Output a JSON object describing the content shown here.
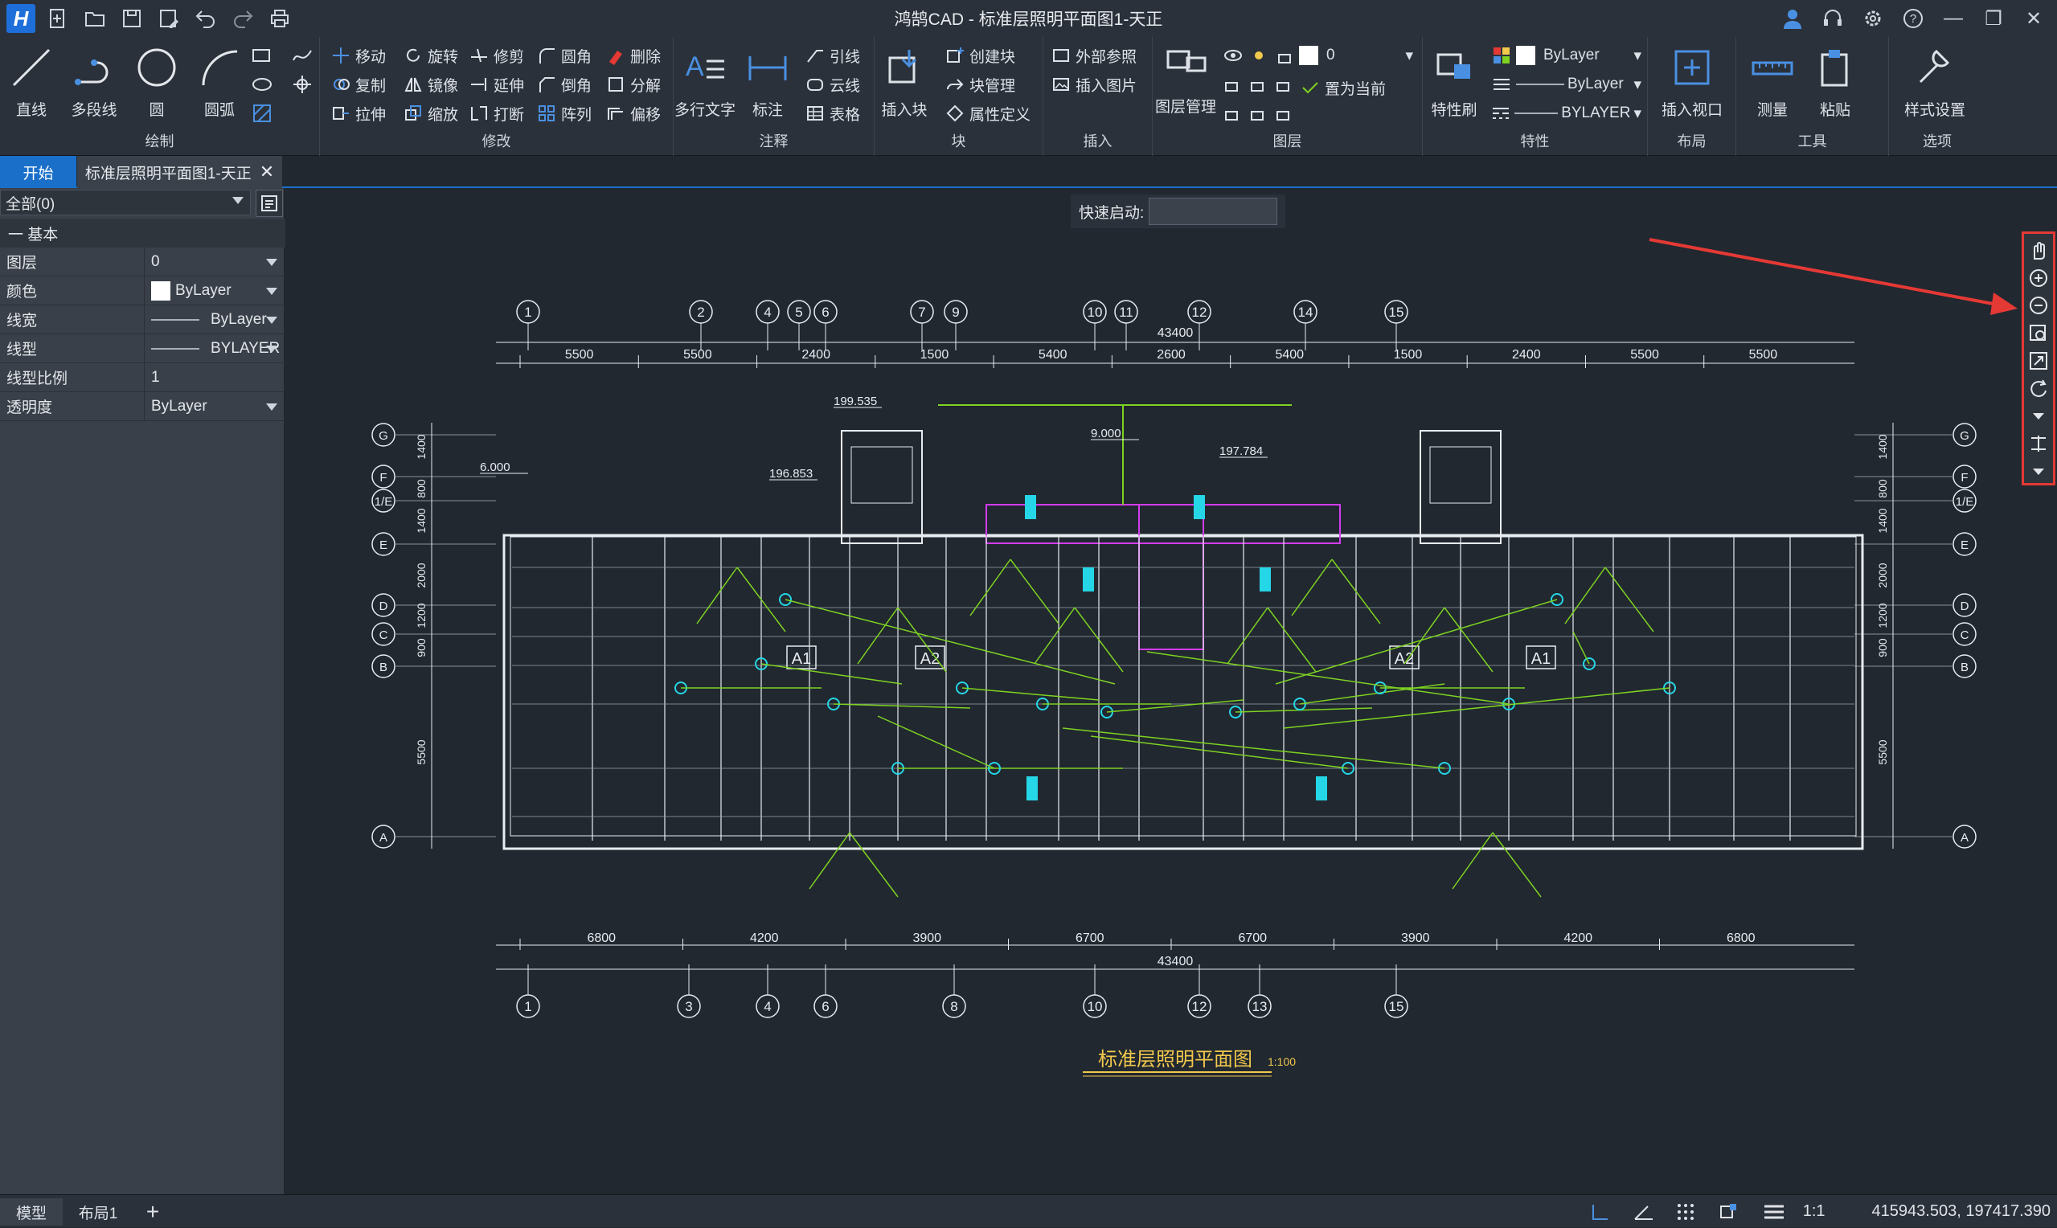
{
  "titlebar": {
    "title": "鸿鹄CAD - 标准层照明平面图1-天正",
    "logo": "H",
    "quick_access": [
      "new-icon",
      "open-icon",
      "save-icon",
      "save-as-icon",
      "undo-icon",
      "redo-icon",
      "print-icon"
    ],
    "right_icons": [
      "user-icon",
      "headset-icon",
      "settings-icon",
      "help-icon"
    ],
    "win": {
      "min": "—",
      "restore": "❐",
      "close": "✕"
    }
  },
  "ribbon": {
    "draw": {
      "label": "绘制",
      "line": "直线",
      "polyline": "多段线",
      "circle": "圆",
      "arc": "圆弧"
    },
    "modify": {
      "label": "修改",
      "move": "移动",
      "rotate": "旋转",
      "trim": "修剪",
      "fillet": "圆角",
      "erase": "删除",
      "copy": "复制",
      "mirror": "镜像",
      "extend": "延伸",
      "chamfer": "倒角",
      "explode": "分解",
      "stretch": "拉伸",
      "scale": "缩放",
      "break": "打断",
      "array": "阵列",
      "offset": "偏移"
    },
    "annotate": {
      "label": "注释",
      "mtext": "多行文字",
      "dim": "标注",
      "leader": "引线",
      "cloud": "云线",
      "table": "表格"
    },
    "block": {
      "label": "块",
      "insert": "插入块",
      "create": "创建块",
      "manage": "块管理",
      "attdef": "属性定义"
    },
    "insert": {
      "label": "插入",
      "xref": "外部参照",
      "image": "插入图片"
    },
    "layer": {
      "label": "图层",
      "manager": "图层管理",
      "current_layer": "0",
      "set_current": "置为当前"
    },
    "properties": {
      "label": "特性",
      "painter": "特性刷",
      "color": "ByLayer",
      "linetype": "ByLayer",
      "lineweight": "BYLAYER"
    },
    "layout": {
      "label": "布局",
      "viewport": "插入视口"
    },
    "tools": {
      "label": "工具",
      "measure": "测量",
      "paste": "粘贴"
    },
    "options": {
      "label": "选项",
      "style": "样式设置"
    }
  },
  "tabs": {
    "start": "开始",
    "doc": "标准层照明平面图1-天正"
  },
  "properties_panel": {
    "selection": "全部(0)",
    "section": "一 基本",
    "rows": [
      {
        "key": "图层",
        "value": "0"
      },
      {
        "key": "颜色",
        "value": "ByLayer"
      },
      {
        "key": "线宽",
        "value": "ByLayer"
      },
      {
        "key": "线型",
        "value": "BYLAYER"
      },
      {
        "key": "线型比例",
        "value": "1"
      },
      {
        "key": "透明度",
        "value": "ByLayer"
      }
    ]
  },
  "quick_launch": {
    "label": "快速启动:",
    "value": ""
  },
  "drawing": {
    "title": "标准层照明平面图",
    "scale": "1:100",
    "top_axes": [
      "1",
      "2",
      "4",
      "5",
      "6",
      "7",
      "9",
      "10",
      "11",
      "12",
      "14",
      "15"
    ],
    "bottom_axes": [
      "1",
      "3",
      "4",
      "6",
      "8",
      "10",
      "12",
      "13",
      "15"
    ],
    "side_axes": [
      "G",
      "F",
      "1/E",
      "E",
      "D",
      "C",
      "B",
      "A"
    ],
    "total_dim": "43400",
    "top_dims": [
      "5500",
      "5500",
      "2400",
      "1500",
      "5400",
      "2600",
      "5400",
      "1500",
      "2400",
      "5500",
      "5500"
    ],
    "bottom_dims": [
      "6800",
      "4200",
      "3900",
      "6700",
      "6700",
      "3900",
      "4200",
      "6800"
    ],
    "left_dims": [
      "1400",
      "800",
      "1400",
      "2000",
      "1200",
      "900",
      "5500"
    ],
    "unit_labels": [
      "A1",
      "A2",
      "A2",
      "A1"
    ],
    "elevations": [
      "6.000",
      "9.000",
      "199.535",
      "197.784",
      "196.853"
    ]
  },
  "nav_bar": [
    "pan-icon",
    "zoom-in-icon",
    "zoom-out-icon",
    "zoom-window-icon",
    "zoom-extents-icon",
    "orbit-icon",
    "chevron-down-icon",
    "measure-icon",
    "chevron-down-icon"
  ],
  "annotation_color": "#e53935",
  "statusbar": {
    "model": "模型",
    "layout": "布局1",
    "add": "+",
    "scale": "1:1",
    "coords": "415943.503, 197417.390"
  }
}
